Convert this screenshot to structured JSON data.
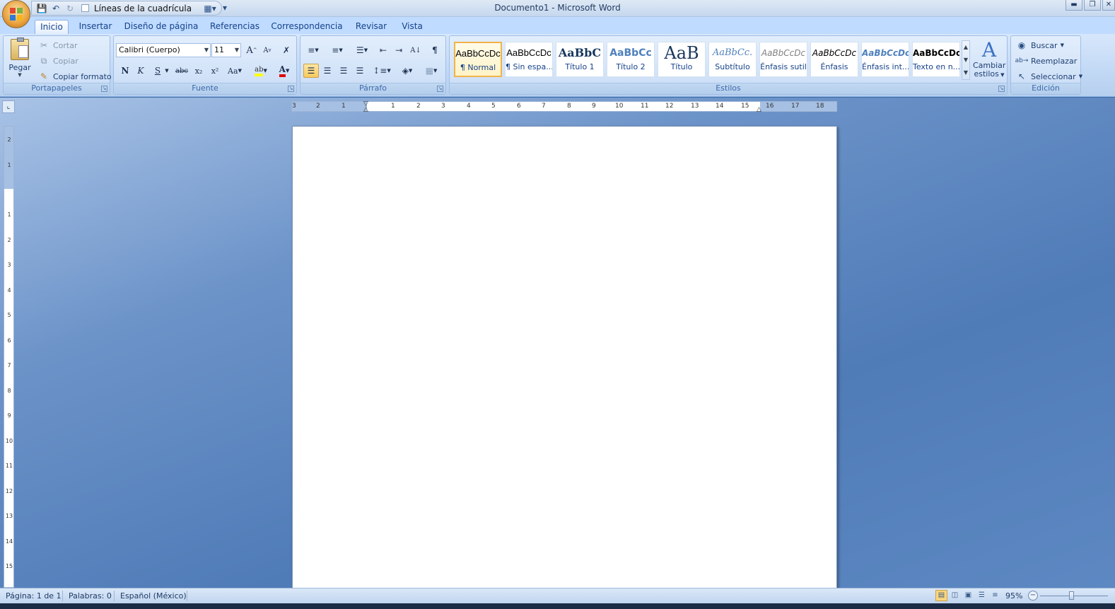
{
  "window": {
    "title": "Documento1 - Microsoft Word",
    "controls": [
      "minimize",
      "restore",
      "close"
    ]
  },
  "qat": {
    "save_icon": "save-icon",
    "undo_icon": "undo-icon",
    "redo_icon": "redo-icon",
    "gridlines_label": "Líneas de la cuadrícula",
    "customize_icon": "customize-qat-icon"
  },
  "tabs": [
    {
      "label": "Inicio",
      "active": true
    },
    {
      "label": "Insertar"
    },
    {
      "label": "Diseño de página"
    },
    {
      "label": "Referencias"
    },
    {
      "label": "Correspondencia"
    },
    {
      "label": "Revisar"
    },
    {
      "label": "Vista"
    }
  ],
  "clipboard": {
    "title": "Portapapeles",
    "paste": "Pegar",
    "cut": "Cortar",
    "copy": "Copiar",
    "format_painter": "Copiar formato"
  },
  "font": {
    "title": "Fuente",
    "family": "Calibri (Cuerpo)",
    "size": "11",
    "bold": "N",
    "italic": "K",
    "underline": "S",
    "strike": "abc",
    "subscript": "x₂",
    "superscript": "x²",
    "change_case": "Aa",
    "grow": "A",
    "shrink": "A"
  },
  "paragraph": {
    "title": "Párrafo",
    "pilcrow": "¶"
  },
  "styles": {
    "title": "Estilos",
    "items": [
      {
        "sample": "AaBbCcDc",
        "name": "¶ Normal",
        "selected": true
      },
      {
        "sample": "AaBbCcDc",
        "name": "¶ Sin espa..."
      },
      {
        "sample": "AaBbC",
        "name": "Título 1"
      },
      {
        "sample": "AaBbCc",
        "name": "Título 2"
      },
      {
        "sample": "AaB",
        "name": "Título"
      },
      {
        "sample": "AaBbCc.",
        "name": "Subtítulo"
      },
      {
        "sample": "AaBbCcDc",
        "name": "Énfasis sutil"
      },
      {
        "sample": "AaBbCcDc",
        "name": "Énfasis"
      },
      {
        "sample": "AaBbCcDc",
        "name": "Énfasis int..."
      },
      {
        "sample": "AaBbCcDc",
        "name": "Texto en n..."
      }
    ],
    "change_styles_line1": "Cambiar",
    "change_styles_line2": "estilos"
  },
  "editing": {
    "title": "Edición",
    "find": "Buscar",
    "replace": "Reemplazar",
    "select": "Seleccionar"
  },
  "ruler": {
    "h_labels": [
      "3",
      "2",
      "1",
      "1",
      "2",
      "3",
      "4",
      "5",
      "6",
      "7",
      "8",
      "9",
      "10",
      "11",
      "12",
      "13",
      "14",
      "15",
      "16",
      "17",
      "18"
    ],
    "v_labels": [
      "2",
      "1",
      "1",
      "2",
      "3",
      "4",
      "5",
      "6",
      "7",
      "8",
      "9",
      "10",
      "11",
      "12",
      "13",
      "14",
      "15"
    ]
  },
  "status": {
    "page": "Página: 1 de 1",
    "words": "Palabras: 0",
    "language": "Español (México)",
    "zoom": "95%"
  }
}
